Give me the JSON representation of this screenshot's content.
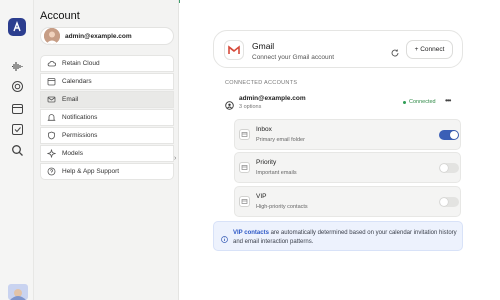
{
  "colors": {
    "accent": "#3b5fb6",
    "connected": "#2f8a47",
    "topbar": "#3f9b6a"
  },
  "panel": {
    "title": "Account",
    "user_email": "admin@example.com",
    "menu": [
      {
        "label": "Retain Cloud",
        "icon": "cloud-icon"
      },
      {
        "label": "Calendars",
        "icon": "calendar-icon"
      },
      {
        "label": "Email",
        "icon": "mail-icon",
        "active": true
      },
      {
        "label": "Notifications",
        "icon": "bell-icon"
      },
      {
        "label": "Permissions",
        "icon": "shield-icon"
      },
      {
        "label": "Models",
        "icon": "sparkle-icon"
      },
      {
        "label": "Help & App Support",
        "icon": "help-icon"
      }
    ]
  },
  "gmail": {
    "name": "Gmail",
    "subtitle": "Connect your Gmail account",
    "connect_label": "+ Connect"
  },
  "connected": {
    "section_label": "CONNECTED ACCOUNTS",
    "email": "admin@example.com",
    "options_count": "3 options",
    "status": "Connected",
    "more": "•••",
    "options": [
      {
        "name": "Inbox",
        "desc": "Primary email folder",
        "enabled": true
      },
      {
        "name": "Priority",
        "desc": "Important emails",
        "enabled": false
      },
      {
        "name": "VIP",
        "desc": "High-priority contacts",
        "enabled": false
      }
    ]
  },
  "info": {
    "strong": "VIP contacts",
    "text": " are automatically determined based on your calendar invitation history and email interaction patterns."
  }
}
